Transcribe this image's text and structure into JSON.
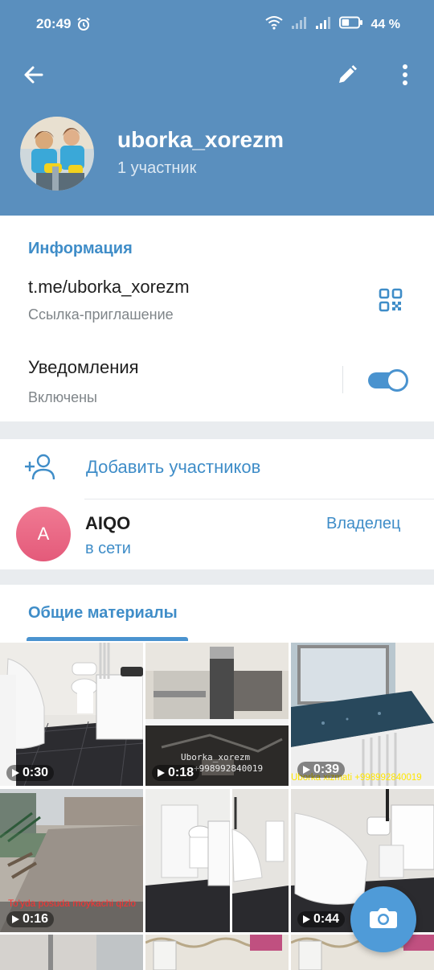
{
  "status_bar": {
    "time": "20:49",
    "battery_percent": "44 %",
    "battery_level": 0.44
  },
  "toolbar": {
    "back_icon": "arrow-left-icon",
    "edit_icon": "pencil-icon",
    "more_icon": "more-vertical-icon"
  },
  "profile": {
    "name": "uborka_xorezm",
    "members_count": "1 участник"
  },
  "info": {
    "section_title": "Информация",
    "link": "t.me/uborka_xorezm",
    "link_caption": "Ссылка-приглашение",
    "notifications_title": "Уведомления",
    "notifications_status": "Включены",
    "notifications_enabled": true
  },
  "members": {
    "add_label": "Добавить участников",
    "list": [
      {
        "initial": "A",
        "name": "AIQO",
        "status": "в сети",
        "role": "Владелец"
      }
    ]
  },
  "media": {
    "tab_label": "Общие материалы",
    "items": [
      {
        "duration": "0:30"
      },
      {
        "duration": "0:18",
        "overlay": "Uborka_xorezm",
        "overlay2": "+998992840019"
      },
      {
        "duration": "0:39",
        "overlay": "Uborka xizmati +998992840019"
      },
      {
        "duration": "0:16",
        "overlay": "To'yda posuda moykachi qizlo"
      },
      {
        "duration": ""
      },
      {
        "duration": "0:44"
      }
    ]
  },
  "fab": {
    "icon": "camera-icon"
  },
  "colors": {
    "header": "#5a8fbe",
    "accent": "#3f8dc8",
    "avatar_pink": "#e45a7a"
  }
}
